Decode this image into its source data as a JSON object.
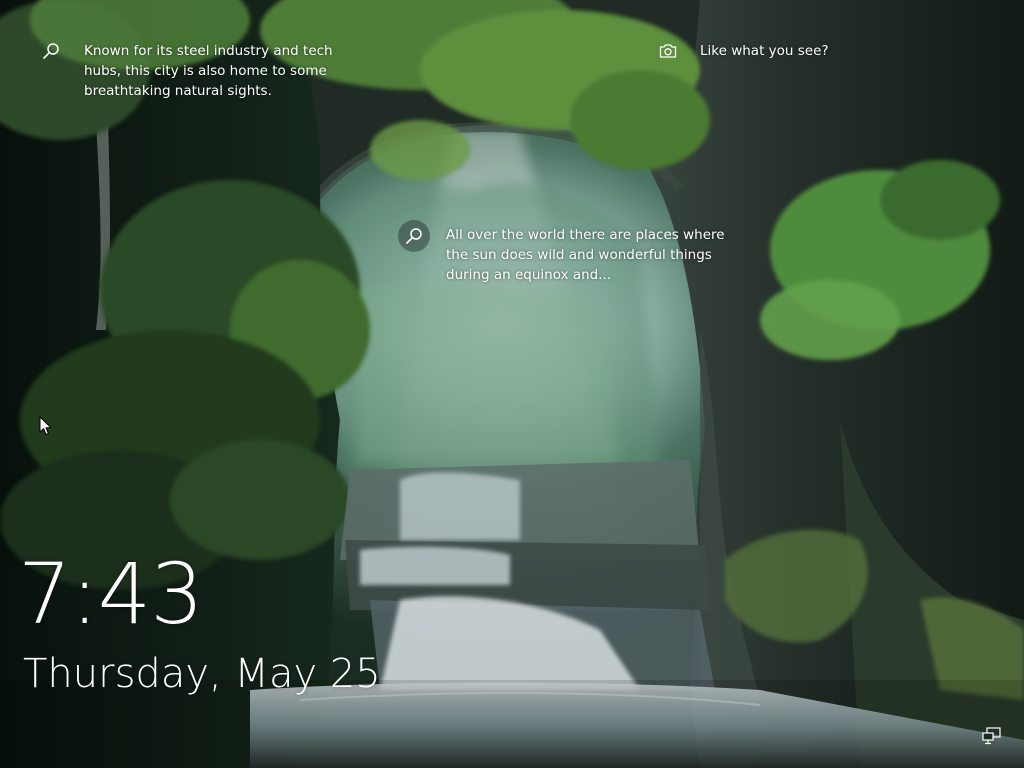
{
  "lockscreen": {
    "hotspot_top": {
      "icon": "search-icon",
      "text": "Known for its steel industry and tech hubs, this city is also home to some breathtaking natural sights."
    },
    "hotspot_center": {
      "icon": "search-icon",
      "text": "All over the world there are places where the sun does wild and wonderful things during an equinox and..."
    },
    "like_link": {
      "icon": "camera-icon",
      "text": "Like what you see?"
    },
    "clock": {
      "time": "7:43",
      "date": "Thursday, May 25"
    },
    "status": {
      "network_icon": "network-wired-icon"
    }
  },
  "colors": {
    "text": "#ffffff",
    "foliage_dark": "#13241a",
    "foliage_light": "#6a9a4a",
    "rock": "#2c3530",
    "light_haze": "#cfe4ea",
    "water": "#c5d6dc"
  }
}
